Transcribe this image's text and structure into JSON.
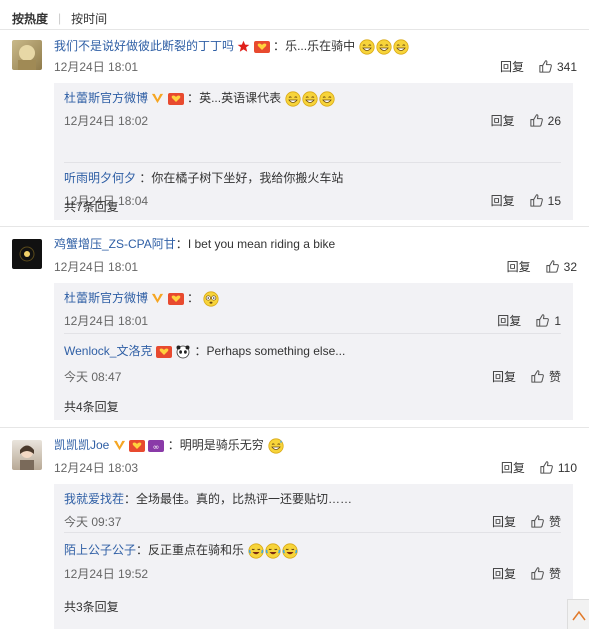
{
  "sort": {
    "by_hot": "按热度",
    "separator": "|",
    "by_time": "按时间"
  },
  "colors": {
    "username": "#2f5fa5",
    "reply_bg": "#f2f2f5",
    "verified": "#f5a623",
    "star": "#e0201a"
  },
  "comments": [
    {
      "user": "我们不是说好做彼此断裂的丁丁吗",
      "text": "乐...乐在骑中",
      "time": "12月24日 18:01",
      "reply_label": "回复",
      "likes": "341",
      "replies": [
        {
          "user": "杜蕾斯官方微博",
          "text": "英...英语课代表",
          "time": "12月24日 18:02",
          "reply_label": "回复",
          "likes": "26"
        },
        {
          "user": "听雨明夕何夕",
          "text": "你在橘子树下坐好，我给你搬火车站",
          "time": "12月24日 18:04",
          "reply_label": "回复",
          "likes": "15"
        }
      ],
      "more": "共7条回复"
    },
    {
      "user": "鸡蟹增压_ZS-CPA阿甘",
      "text": "I bet you mean riding a bike",
      "time": "12月24日 18:01",
      "reply_label": "回复",
      "likes": "32",
      "replies": [
        {
          "user": "杜蕾斯官方微博",
          "text": "",
          "time": "12月24日 18:01",
          "reply_label": "回复",
          "likes": "1"
        },
        {
          "user": "Wenlock_文洛克",
          "text": "Perhaps something else...",
          "time": "今天 08:47",
          "reply_label": "回复",
          "likes": "赞"
        }
      ],
      "more": "共4条回复"
    },
    {
      "user": "凯凯凯Joe",
      "text": "明明是骑乐无穷",
      "time": "12月24日 18:03",
      "reply_label": "回复",
      "likes": "110",
      "replies": [
        {
          "user": "我就爱找茬",
          "text": "全场最佳。真的，比热评一还要贴切……",
          "time": "今天 09:37",
          "reply_label": "回复",
          "likes": "赞"
        },
        {
          "user": "陌上公子公子",
          "text": "反正重点在骑和乐",
          "time": "12月24日 19:52",
          "reply_label": "回复",
          "likes": "赞"
        }
      ],
      "more": "共3条回复"
    }
  ]
}
